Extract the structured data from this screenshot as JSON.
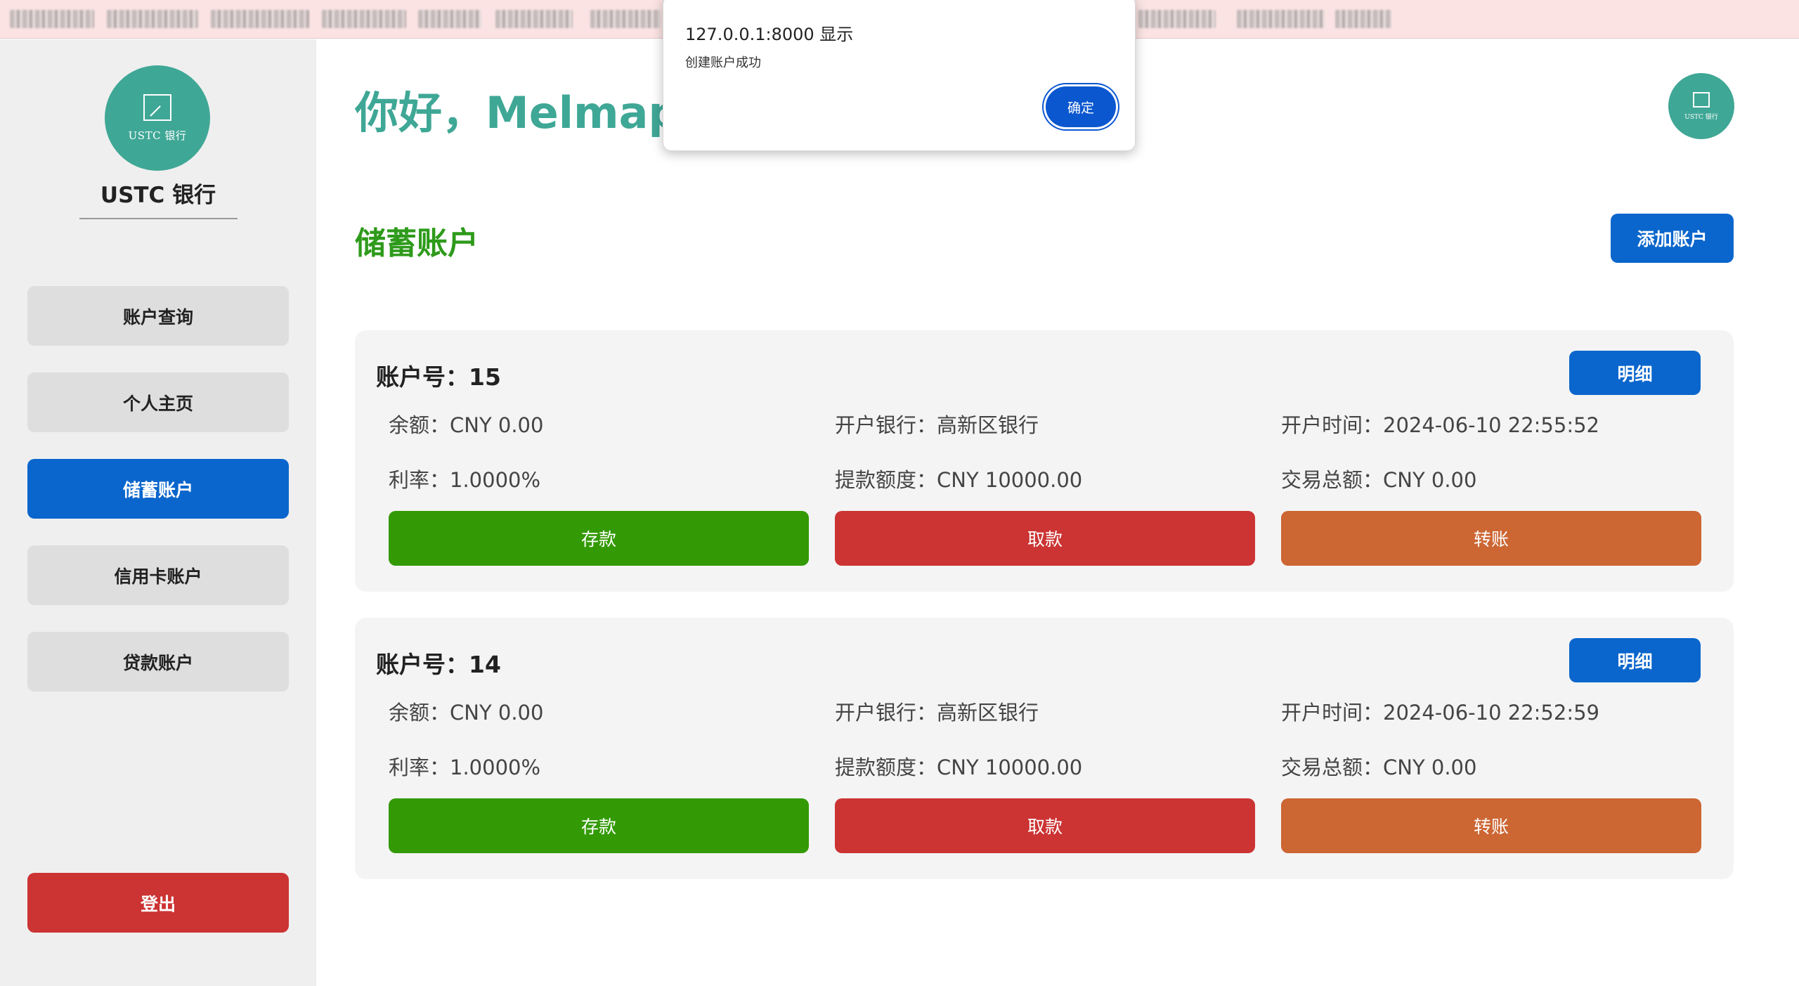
{
  "sidebar": {
    "logo_text": "USTC 银行",
    "bank_name": "USTC 银行",
    "nav": [
      {
        "label": "账户查询"
      },
      {
        "label": "个人主页"
      },
      {
        "label": "储蓄账户"
      },
      {
        "label": "信用卡账户"
      },
      {
        "label": "贷款账户"
      }
    ],
    "active_index": 2,
    "logout_label": "登出"
  },
  "header": {
    "greeting": "你好，Melmaph",
    "avatar_text": "USTC 银行"
  },
  "section": {
    "title": "储蓄账户",
    "add_label": "添加账户"
  },
  "accounts": [
    {
      "title": "账户号：15",
      "detail_label": "明细",
      "balance": "余额：CNY 0.00",
      "bank": "开户银行：高新区银行",
      "open_time": "开户时间：2024-06-10 22:55:52",
      "rate": "利率：1.0000%",
      "withdraw_limit": "提款额度：CNY 10000.00",
      "trade_total": "交易总额：CNY 0.00",
      "deposit_label": "存款",
      "withdraw_label": "取款",
      "transfer_label": "转账"
    },
    {
      "title": "账户号：14",
      "detail_label": "明细",
      "balance": "余额：CNY 0.00",
      "bank": "开户银行：高新区银行",
      "open_time": "开户时间：2024-06-10 22:52:59",
      "rate": "利率：1.0000%",
      "withdraw_limit": "提款额度：CNY 10000.00",
      "trade_total": "交易总额：CNY 0.00",
      "deposit_label": "存款",
      "withdraw_label": "取款",
      "transfer_label": "转账"
    }
  ],
  "dialog": {
    "title": "127.0.0.1:8000 显示",
    "message": "创建账户成功",
    "ok_label": "确定"
  },
  "colors": {
    "brand_teal": "#3fa796",
    "primary_blue": "#0a66cc",
    "section_green": "#2e9a1b",
    "deposit_green": "#339a05",
    "withdraw_red": "#cc3333",
    "transfer_orange": "#cc6633"
  }
}
